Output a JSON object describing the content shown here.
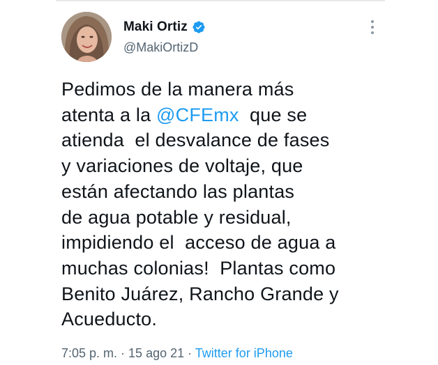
{
  "author": {
    "display_name": "Maki Ortiz",
    "handle": "@MakiOrtizD",
    "verified": true,
    "avatar_icon": "profile-photo"
  },
  "tweet": {
    "lines": [
      {
        "before": "Pedimos de la manera más",
        "mention": "",
        "after": ""
      },
      {
        "before": "atenta a la ",
        "mention": "@CFEmx",
        "after": "  que se"
      },
      {
        "before": "atienda  el desvalance de fases",
        "mention": "",
        "after": ""
      },
      {
        "before": "y variaciones de voltaje, que",
        "mention": "",
        "after": ""
      },
      {
        "before": "están afectando las plantas",
        "mention": "",
        "after": ""
      },
      {
        "before": "de agua potable y residual,",
        "mention": "",
        "after": ""
      },
      {
        "before": "impidiendo el  acceso de agua a",
        "mention": "",
        "after": ""
      },
      {
        "before": "muchas colonias!  Plantas como",
        "mention": "",
        "after": ""
      },
      {
        "before": "Benito Juárez, Rancho Grande y",
        "mention": "",
        "after": ""
      },
      {
        "before": "Acueducto.",
        "mention": "",
        "after": ""
      }
    ]
  },
  "meta": {
    "time": "7:05 p. m.",
    "separator": " · ",
    "date": "15 ago 21",
    "source": "Twitter for iPhone"
  },
  "colors": {
    "link": "#1d9bf0",
    "text": "#0f1419",
    "secondary": "#536471",
    "verified": "#1d9bf0"
  }
}
